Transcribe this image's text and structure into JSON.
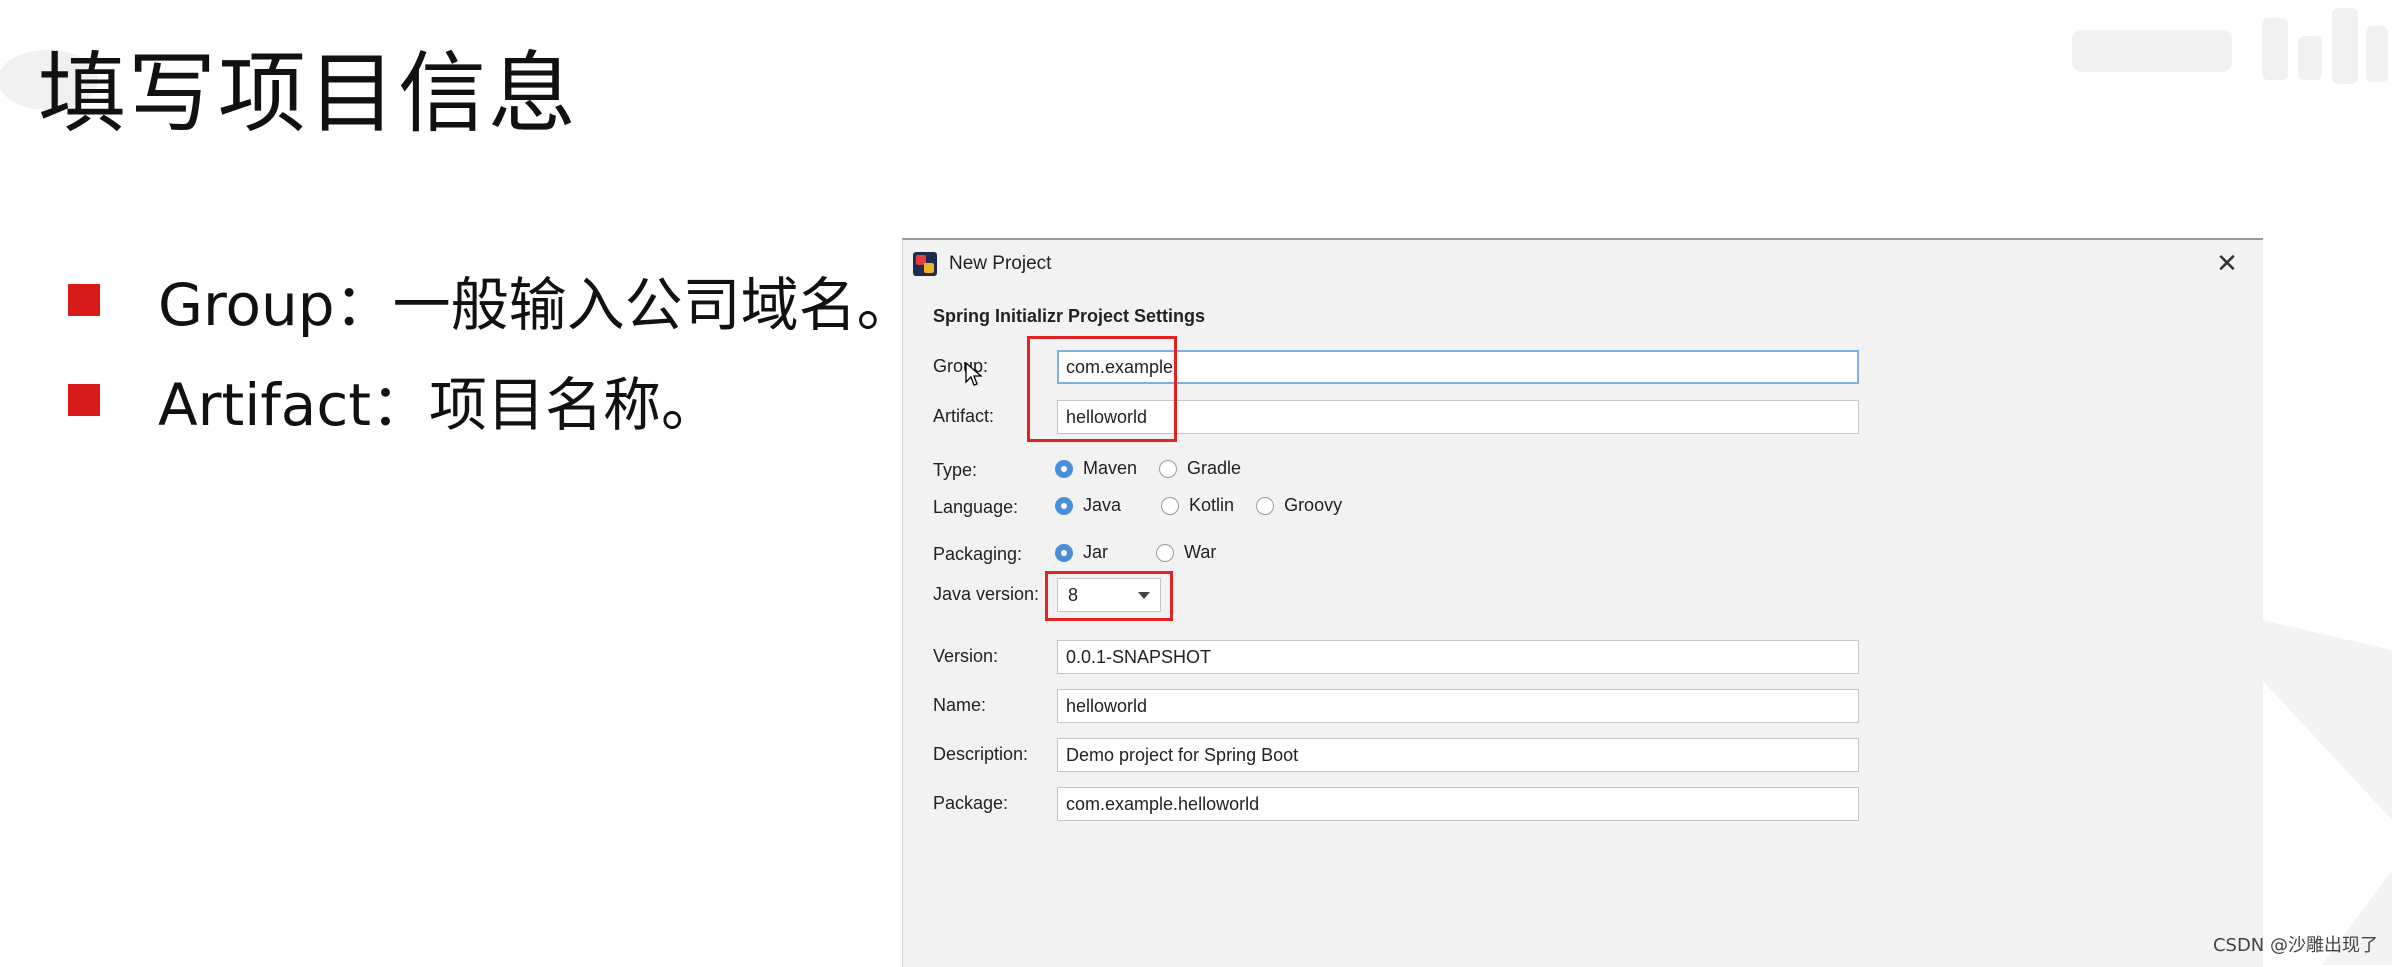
{
  "slide": {
    "title": "填写项目信息",
    "bullets": [
      {
        "text": "Group：一般输入公司域名。"
      },
      {
        "text": "Artifact：项目名称。"
      }
    ],
    "footer": "CSDN @沙雕出现了",
    "accent_color": "#d71a1a"
  },
  "dialog": {
    "title": "New Project",
    "close_icon": "close-icon",
    "section_title": "Spring Initializr Project Settings",
    "group": {
      "label": "Group:",
      "value": "com.example"
    },
    "artifact": {
      "label": "Artifact:",
      "value": "helloworld"
    },
    "type": {
      "label": "Type:",
      "options": [
        "Maven",
        "Gradle"
      ],
      "selected": "Maven"
    },
    "language": {
      "label": "Language:",
      "options": [
        "Java",
        "Kotlin",
        "Groovy"
      ],
      "selected": "Java"
    },
    "packaging": {
      "label": "Packaging:",
      "options": [
        "Jar",
        "War"
      ],
      "selected": "Jar"
    },
    "java_version": {
      "label": "Java version:",
      "value": "8"
    },
    "version": {
      "label": "Version:",
      "value": "0.0.1-SNAPSHOT"
    },
    "name": {
      "label": "Name:",
      "value": "helloworld"
    },
    "description": {
      "label": "Description:",
      "value": "Demo project for Spring Boot"
    },
    "package": {
      "label": "Package:",
      "value": "com.example.helloworld"
    },
    "highlight_color": "#e02424"
  }
}
